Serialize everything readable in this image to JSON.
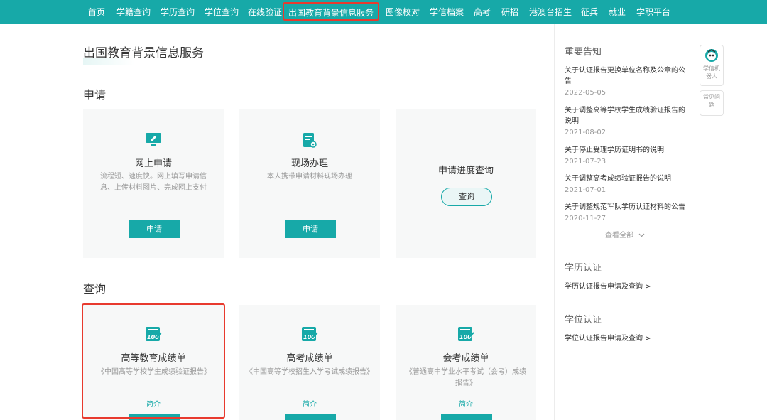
{
  "nav": {
    "items": [
      "首页",
      "学籍查询",
      "学历查询",
      "学位查询",
      "在线验证",
      "出国教育背景信息服务",
      "图像校对",
      "学信档案",
      "高考",
      "研招",
      "港澳台招生",
      "征兵",
      "就业",
      "学职平台"
    ]
  },
  "page": {
    "title": "出国教育背景信息服务"
  },
  "apply": {
    "section_title": "申请",
    "online": {
      "title": "网上申请",
      "desc": "流程短、速度快。网上填写申请信息、上传材料图片、完成网上支付",
      "button": "申请"
    },
    "onsite": {
      "title": "现场办理",
      "desc": "本人携带申请材料现场办理",
      "button": "申请"
    },
    "progress": {
      "title": "申请进度查询",
      "button": "查询"
    }
  },
  "query": {
    "section_title": "查询",
    "higher_ed": {
      "title": "高等教育成绩单",
      "desc": "《中国高等学校学生成绩验证报告》",
      "link": "简介"
    },
    "gaokao": {
      "title": "高考成绩单",
      "desc": "《中国高等学校招生入学考试成绩报告》",
      "link": "简介"
    },
    "huikao": {
      "title": "会考成绩单",
      "desc": "《普通高中学业水平考试（会考）成绩报告》",
      "link": "简介"
    }
  },
  "sidebar": {
    "notices_title": "重要告知",
    "notices": [
      {
        "title": "关于认证报告更换单位名称及公章的公告",
        "date": "2022-05-05"
      },
      {
        "title": "关于调整高等学校学生成绩验证报告的说明",
        "date": "2021-08-02"
      },
      {
        "title": "关于停止受理学历证明书的说明",
        "date": "2021-07-23"
      },
      {
        "title": "关于调整高考成绩验证报告的说明",
        "date": "2021-07-01"
      },
      {
        "title": "关于调整规范军队学历认证材料的公告",
        "date": "2020-11-27"
      }
    ],
    "view_all": "查看全部",
    "degree_cert": {
      "title": "学历认证",
      "link": "学历认证报告申请及查询 >"
    },
    "xuewei_cert": {
      "title": "学位认证",
      "link": "学位认证报告申请及查询 >"
    }
  },
  "float": {
    "robot_label": "学信机器人",
    "faq_label": "常见问题"
  },
  "colors": {
    "brand": "#17a9a8",
    "highlight": "#e83a2e",
    "card_bg": "#f7f8f8"
  }
}
